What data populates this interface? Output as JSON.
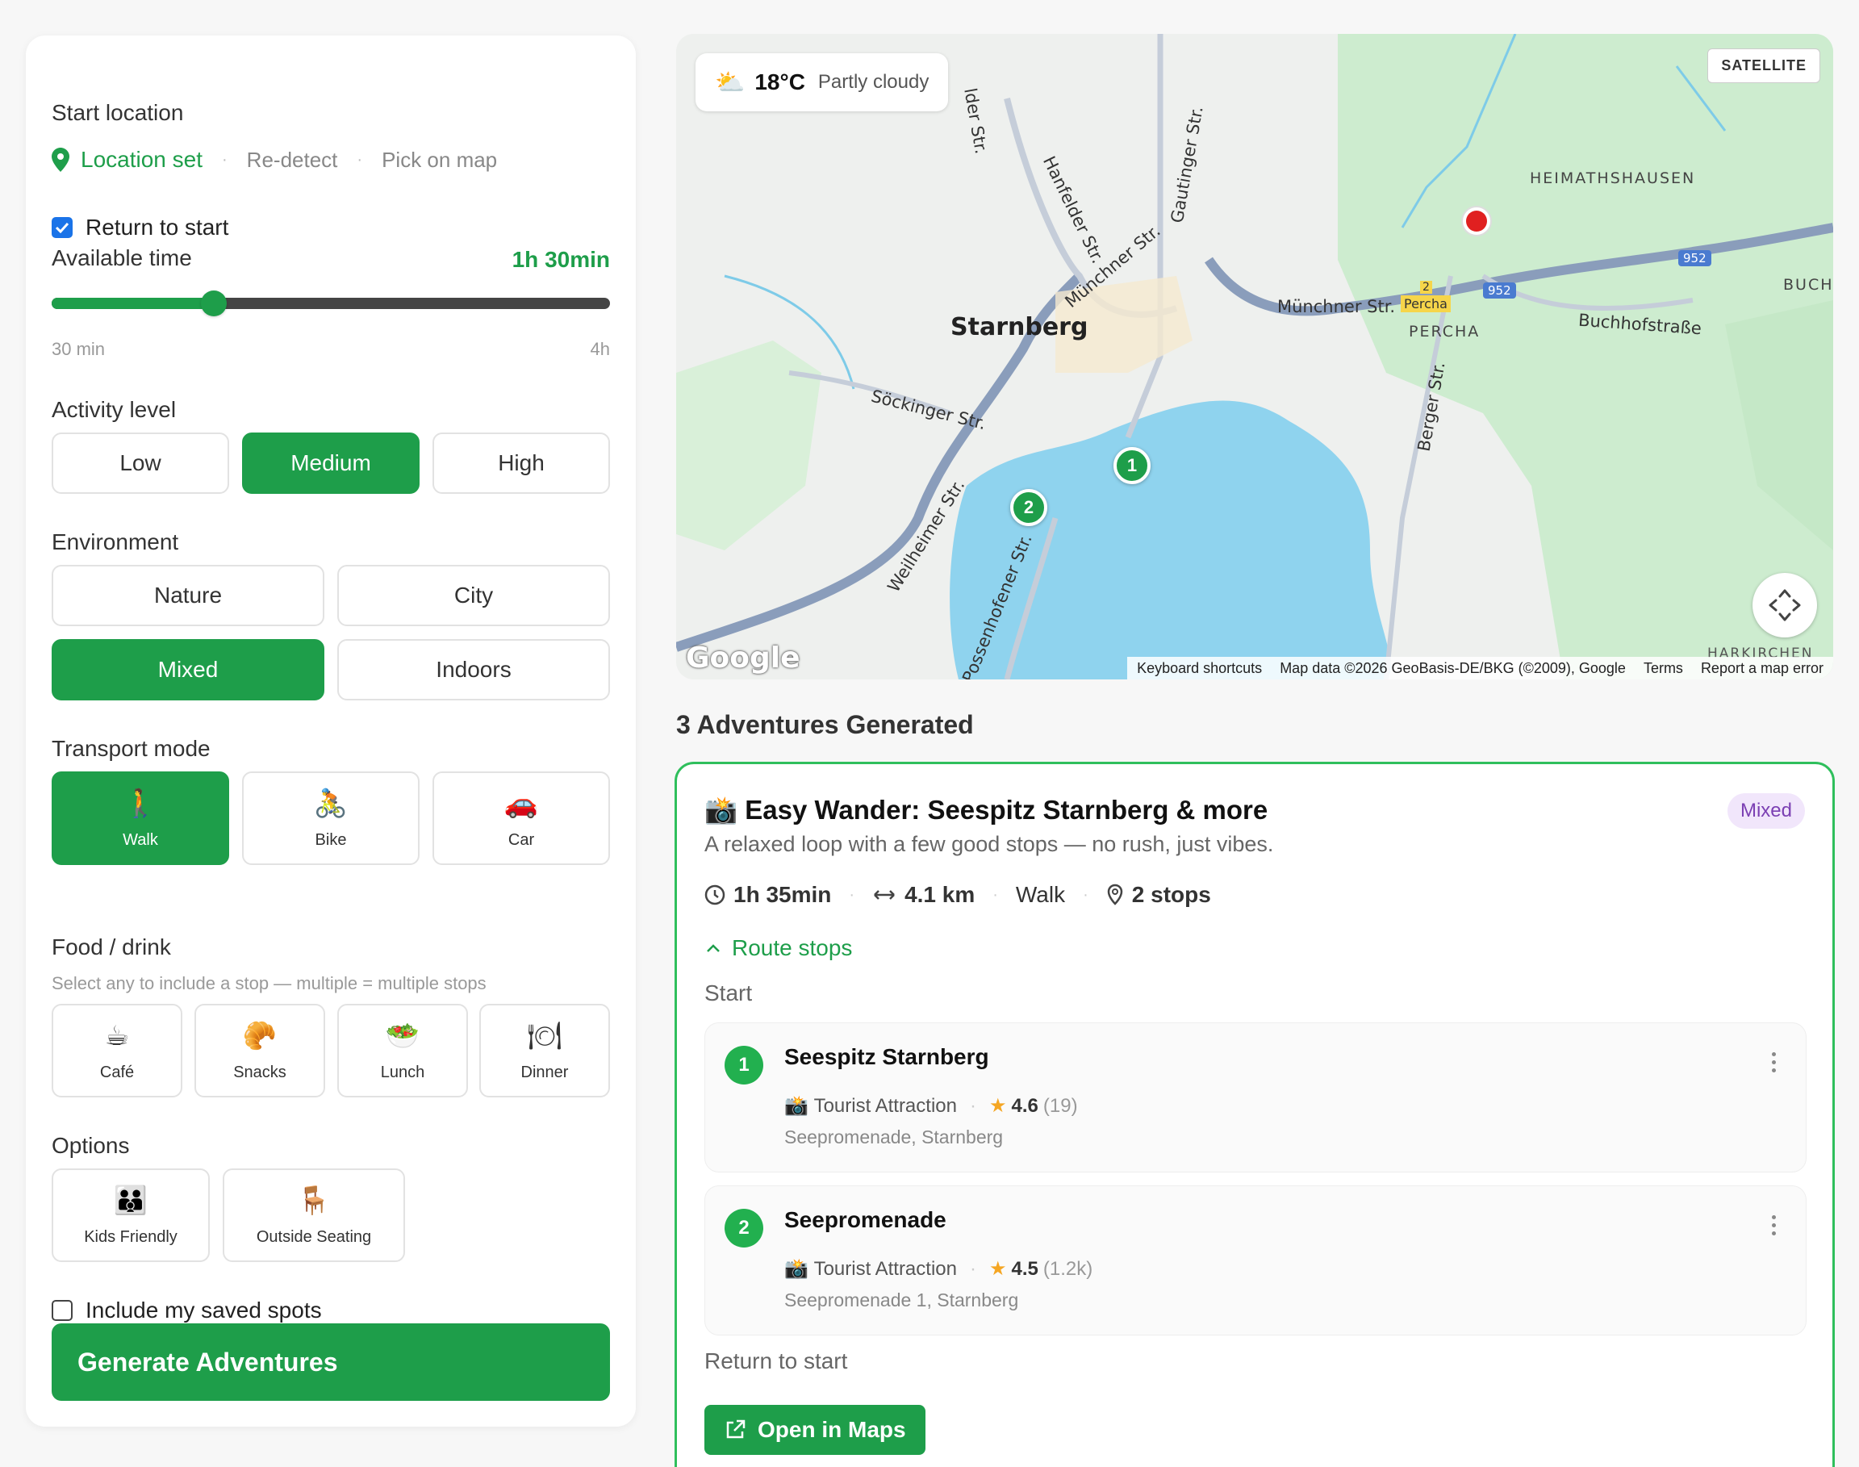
{
  "sidebar": {
    "start_location": {
      "label": "Start location",
      "status": "Location set",
      "redetect": "Re-detect",
      "pick": "Pick on map"
    },
    "return_to_start": {
      "label": "Return to start",
      "checked": true
    },
    "available_time": {
      "label": "Available time",
      "value": "1h 30min",
      "min_label": "30 min",
      "max_label": "4h",
      "fraction": 0.29
    },
    "activity_level": {
      "label": "Activity level",
      "options": [
        "Low",
        "Medium",
        "High"
      ],
      "selected": "Medium"
    },
    "environment": {
      "label": "Environment",
      "options": [
        "Nature",
        "City",
        "Mixed",
        "Indoors"
      ],
      "selected": "Mixed"
    },
    "transport_mode": {
      "label": "Transport mode",
      "options": [
        {
          "label": "Walk",
          "icon": "🚶"
        },
        {
          "label": "Bike",
          "icon": "🚴"
        },
        {
          "label": "Car",
          "icon": "🚗"
        }
      ],
      "selected": "Walk"
    },
    "food_drink": {
      "label": "Food / drink",
      "hint": "Select any to include a stop — multiple = multiple stops",
      "options": [
        {
          "label": "Café",
          "icon": "☕"
        },
        {
          "label": "Snacks",
          "icon": "🥐"
        },
        {
          "label": "Lunch",
          "icon": "🥗"
        },
        {
          "label": "Dinner",
          "icon": "🍽"
        }
      ]
    },
    "options": {
      "label": "Options",
      "items": [
        {
          "label": "Kids Friendly",
          "icon": "👪"
        },
        {
          "label": "Outside Seating",
          "icon": "🪑"
        }
      ]
    },
    "saved_spots": {
      "label": "Include my saved spots",
      "checked": false
    },
    "generate_button": "Generate Adventures"
  },
  "map": {
    "weather": {
      "icon": "⛅",
      "temp": "18°C",
      "condition": "Partly cloudy"
    },
    "satellite_button": "SATELLITE",
    "labels": {
      "starnberg": "Starnberg",
      "heimathausen": "HEIMATHSHAUSEN",
      "percha": "PERCHA",
      "buch": "BUCH",
      "harkirchen": "HARKIRCHEN",
      "muenchner1": "Münchner Str.",
      "muenchner2": "Münchner Str.",
      "buchhof": "Buchhofstraße",
      "soecking": "Söckinger Str.",
      "weilheimer": "Weilheimer Str.",
      "possenhofener": "Possenhofener Str.",
      "hanfelder": "Hanfelder Str.",
      "gautinger": "Gautinger Str.",
      "berger": "Berger Str.",
      "sder": "lder Str.",
      "percha_sign": "Percha",
      "road952a": "952",
      "road952b": "952",
      "exit2": "2"
    },
    "markers": [
      "1",
      "2"
    ],
    "google": "Google",
    "attribution": {
      "shortcuts": "Keyboard shortcuts",
      "data": "Map data ©2026 GeoBasis-DE/BKG (©2009), Google",
      "terms": "Terms",
      "report": "Report a map error"
    }
  },
  "results": {
    "title": "3 Adventures Generated",
    "card": {
      "icon": "📸",
      "title": "Easy Wander: Seespitz Starnberg & more",
      "description": "A relaxed loop with a few good stops — no rush, just vibes.",
      "badge": "Mixed",
      "duration": "1h 35min",
      "distance": "4.1 km",
      "mode": "Walk",
      "stops_count": "2 stops",
      "route_toggle": "Route stops",
      "start_label": "Start",
      "stops": [
        {
          "num": "1",
          "name": "Seespitz Starnberg",
          "icon": "📸",
          "category": "Tourist Attraction",
          "rating": "4.6",
          "count": "(19)",
          "address": "Seepromenade, Starnberg"
        },
        {
          "num": "2",
          "name": "Seepromenade",
          "icon": "📸",
          "category": "Tourist Attraction",
          "rating": "4.5",
          "count": "(1.2k)",
          "address": "Seepromenade 1, Starnberg"
        }
      ],
      "return_label": "Return to start",
      "open_button": "Open in Maps"
    }
  },
  "colors": {
    "accent": "#1e9e4a",
    "card_border": "#2fbf5c",
    "badge_bg": "#f1e6fb",
    "badge_text": "#7b3fb3",
    "lake": "#8fd3ee"
  }
}
